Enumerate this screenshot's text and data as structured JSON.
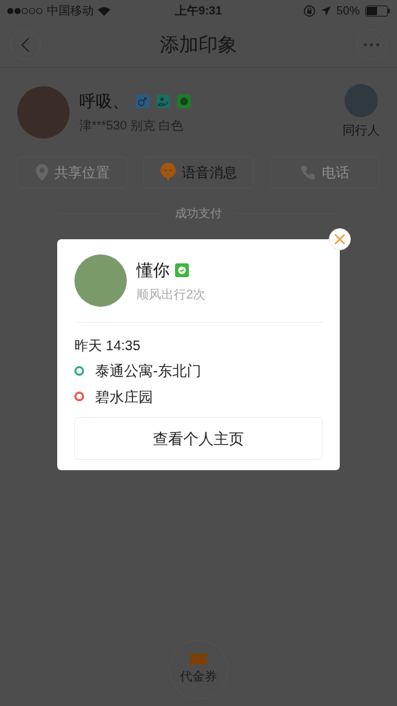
{
  "status_bar": {
    "carrier": "中国移动",
    "time": "上午9:31",
    "battery": "50%"
  },
  "nav": {
    "title": "添加印象"
  },
  "driver": {
    "name": "呼吸、",
    "plate": "津***530 别克 白色",
    "companion_label": "同行人"
  },
  "actions": [
    {
      "label": "共享位置",
      "kind": "location",
      "disabled": true
    },
    {
      "label": "语音消息",
      "kind": "voice",
      "disabled": false
    },
    {
      "label": "电话",
      "kind": "phone",
      "disabled": true
    }
  ],
  "divider_label": "成功支付",
  "popup": {
    "name": "懂你",
    "trips": "顺风出行2次",
    "time": "昨天 14:35",
    "stops": [
      {
        "name": "泰通公寓-东北门",
        "color": "#2daf77"
      },
      {
        "name": "碧水庄园",
        "color": "#ea5550"
      }
    ],
    "button": "查看个人主页"
  },
  "voucher": {
    "label": "代金券"
  }
}
